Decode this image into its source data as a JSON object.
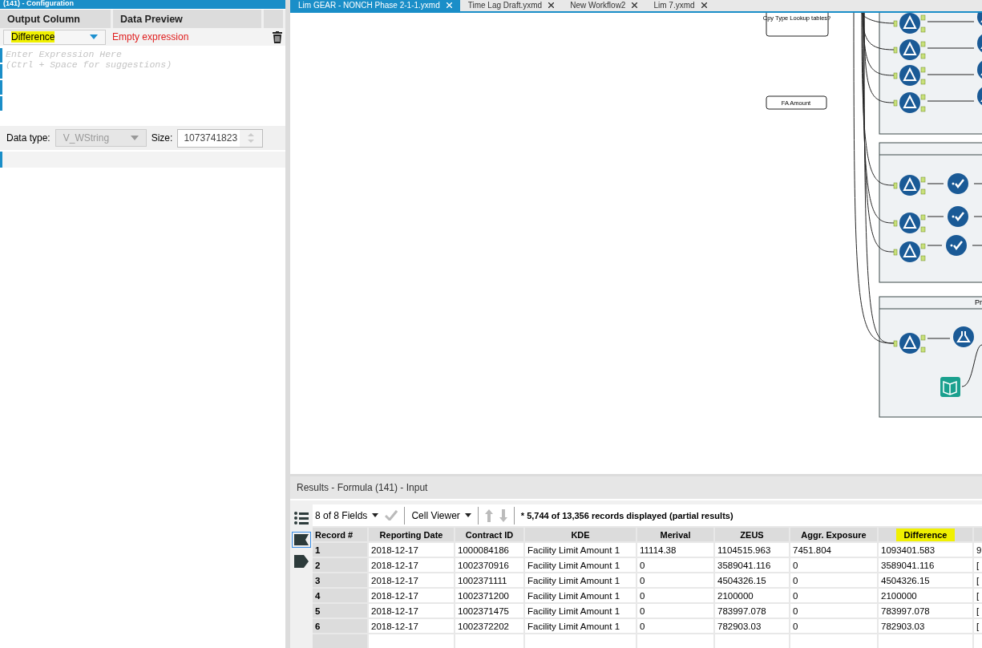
{
  "config_panel": {
    "title": "(141) - Configuration",
    "columns": [
      "Output Column",
      "Data Preview"
    ],
    "output_column": {
      "value": "Difference",
      "highlighted": true
    },
    "preview": "Empty expression",
    "expression": {
      "placeholder": "Enter Expression Here\n(Ctrl + Space for suggestions)"
    },
    "data_type_label": "Data type:",
    "data_type": {
      "value": "V_WString",
      "disabled": true
    },
    "size_label": "Size:",
    "size": "1073741823"
  },
  "tabs": [
    {
      "label": "Lim GEAR - NONCH Phase 2-1-1.yxmd",
      "selected": true
    },
    {
      "label": "Time Lag Draft.yxmd",
      "selected": false
    },
    {
      "label": "New Workflow2",
      "selected": false
    },
    {
      "label": "Lim 7.yxmd",
      "selected": false
    }
  ],
  "canvas": {
    "comments": [
      "Cpy Type Lookup tables?",
      "FA Amount"
    ],
    "container_label": "Pr"
  },
  "results": {
    "title": "Results - Formula (141) - Input",
    "fields": "8 of 8 Fields",
    "viewer": "Cell Viewer",
    "summary": "* 5,744 of 13,356 records displayed (partial results)",
    "columns": [
      {
        "label": "Record #",
        "highlighted": false
      },
      {
        "label": "Reporting Date",
        "highlighted": false
      },
      {
        "label": "Contract ID",
        "highlighted": false
      },
      {
        "label": "KDE",
        "highlighted": false
      },
      {
        "label": "Merival",
        "highlighted": false
      },
      {
        "label": "ZEUS",
        "highlighted": false
      },
      {
        "label": "Aggr. Exposure",
        "highlighted": false
      },
      {
        "label": "Difference",
        "highlighted": true
      }
    ],
    "rows": [
      [
        "1",
        "2018-12-17",
        "1000084186",
        "Facility Limit Amount 1",
        "11114.38",
        "1104515.963",
        "7451.804",
        "1093401.583",
        "9"
      ],
      [
        "2",
        "2018-12-17",
        "1002370916",
        "Facility Limit Amount 1",
        "0",
        "3589041.116",
        "0",
        "3589041.116",
        "["
      ],
      [
        "3",
        "2018-12-17",
        "1002371111",
        "Facility Limit Amount 1",
        "0",
        "4504326.15",
        "0",
        "4504326.15",
        "["
      ],
      [
        "4",
        "2018-12-17",
        "1002371200",
        "Facility Limit Amount 1",
        "0",
        "2100000",
        "0",
        "2100000",
        "["
      ],
      [
        "5",
        "2018-12-17",
        "1002371475",
        "Facility Limit Amount 1",
        "0",
        "783997.078",
        "0",
        "783997.078",
        "["
      ],
      [
        "6",
        "2018-12-17",
        "1002372202",
        "Facility Limit Amount 1",
        "0",
        "782903.03",
        "0",
        "782903.03",
        "["
      ]
    ]
  }
}
